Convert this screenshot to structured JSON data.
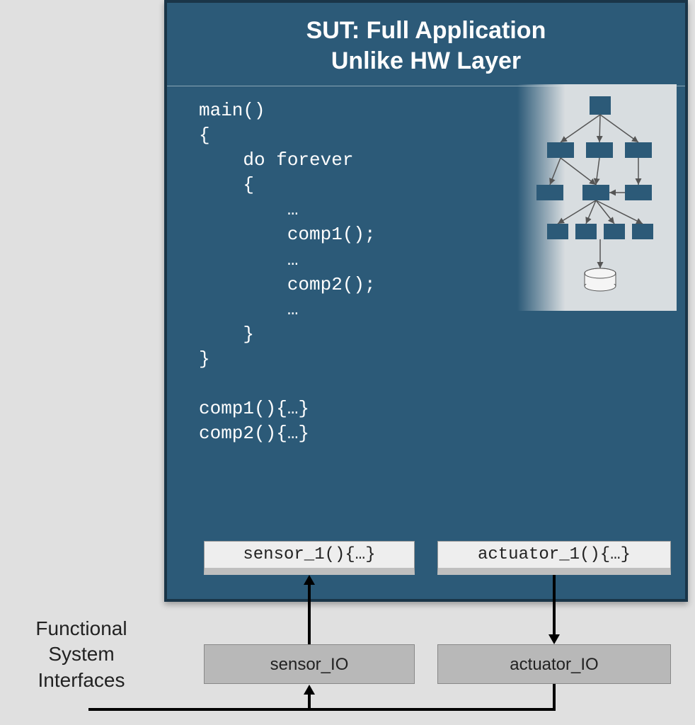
{
  "title_line1": "SUT: Full Application",
  "title_line2": "Unlike HW Layer",
  "code": "main()\n{\n    do forever\n    {\n        …\n        comp1();\n        …\n        comp2();\n        …\n    }\n}\n\ncomp1(){…}\ncomp2(){…}",
  "sensor_fn": "sensor_1(){…}",
  "actuator_fn": "actuator_1(){…}",
  "sensor_io": "sensor_IO",
  "actuator_io": "actuator_IO",
  "side_label_l1": "Functional",
  "side_label_l2": "System",
  "side_label_l3": "Interfaces"
}
